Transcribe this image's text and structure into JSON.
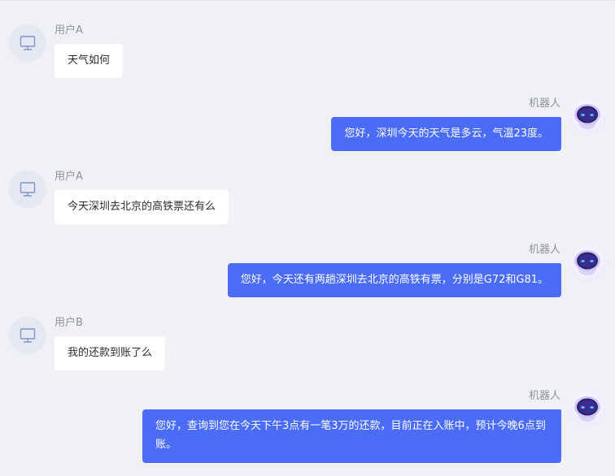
{
  "conversation": [
    {
      "sender": "user",
      "name": "用户A",
      "text": "天气如何"
    },
    {
      "sender": "bot",
      "name": "机器人",
      "text": "您好，深圳今天的天气是多云，气温23度。"
    },
    {
      "sender": "user",
      "name": "用户A",
      "text": "今天深圳去北京的高铁票还有么"
    },
    {
      "sender": "bot",
      "name": "机器人",
      "text": "您好，今天还有两趟深圳去北京的高铁有票，分别是G72和G81。"
    },
    {
      "sender": "user",
      "name": "用户B",
      "text": "我的还款到账了么"
    },
    {
      "sender": "bot",
      "name": "机器人",
      "text": "您好，查询到您在今天下午3点有一笔3万的还款，目前正在入账中，预计今晚6点到账。"
    }
  ],
  "icons": {
    "user_avatar": "monitor-icon",
    "bot_avatar": "robot-icon"
  },
  "colors": {
    "background": "#f0f1f5",
    "bot_bubble": "#4a6cf7",
    "user_bubble": "#ffffff",
    "name_text": "#8d929e"
  }
}
